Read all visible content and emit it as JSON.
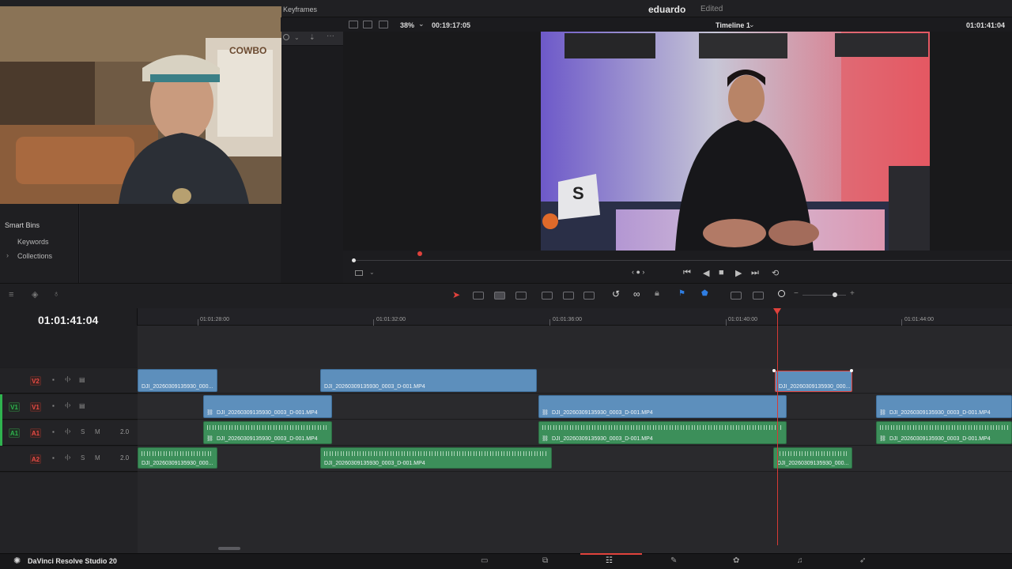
{
  "app": {
    "name": "DaVinci Resolve Studio 20"
  },
  "header": {
    "project_name": "eduardo",
    "project_status": "Edited",
    "keyframes_label": "Keyframes"
  },
  "viewer": {
    "zoom": "38%",
    "source_timecode": "00:19:17:05",
    "timeline_name": "Timeline 1",
    "record_timecode": "01:01:41:04"
  },
  "media_pool": {
    "smart_bins_title": "Smart Bins",
    "items": [
      "Keywords",
      "Collections"
    ]
  },
  "timeline": {
    "current_timecode": "01:01:41:04",
    "ruler_labels": [
      "01:01:28:00",
      "01:01:32:00",
      "01:01:36:00",
      "01:01:40:00",
      "01:01:44:00"
    ],
    "tracks": [
      {
        "id": "V2",
        "src": "",
        "level": ""
      },
      {
        "id": "V1",
        "src": "V1",
        "level": ""
      },
      {
        "id": "A1",
        "src": "A1",
        "level": "2.0",
        "solo": "S",
        "mute": "M"
      },
      {
        "id": "A2",
        "src": "",
        "level": "2.0",
        "solo": "S",
        "mute": "M"
      }
    ],
    "clips": {
      "v2_a": "DJI_20260309135930_000...",
      "v2_b": "DJI_20260309135930_0003_D-001.MP4",
      "v2_c": "DJI_20260309135930_000...",
      "v1_a": "DJI_20260309135930_0003_D-001.MP4",
      "v1_b": "DJI_20260309135930_0003_D-001.MP4",
      "v1_c": "DJI_20260309135930_0003_D-001.MP4",
      "a1_a": "DJI_20260309135930_0003_D-001.MP4",
      "a1_b": "DJI_20260309135930_0003_D-001.MP4",
      "a1_c": "DJI_20260309135930_0003_D-001.MP4",
      "a2_a": "DJI_20260309135930_000...",
      "a2_b": "DJI_20260309135930_0003_D-001.MP4",
      "a2_c": "DJI_20260309135930_000..."
    }
  },
  "icons": {
    "link": "link-icon",
    "play": "play-icon",
    "stop": "stop-icon",
    "prev": "previous-frame-icon",
    "next": "next-frame-icon",
    "first": "first-frame-icon",
    "last": "last-frame-icon",
    "loop": "loop-icon"
  },
  "colors": {
    "playhead": "#e0423c",
    "video_clip": "#5d8fbc",
    "audio_clip": "#3c8f5a"
  }
}
